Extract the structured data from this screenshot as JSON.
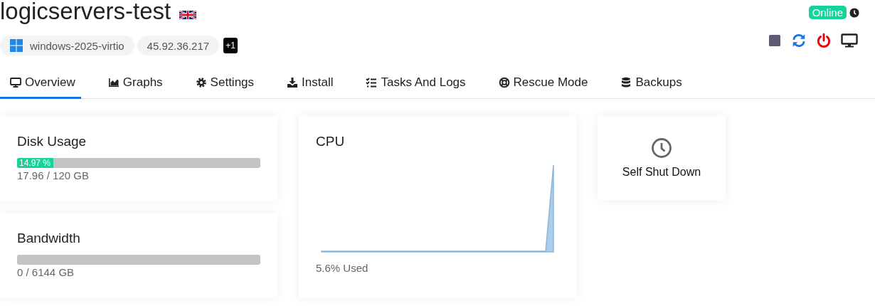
{
  "server": {
    "name": "logicservers-test",
    "status": "Online"
  },
  "chips": [
    {
      "kind": "os",
      "label": "windows-2025-virtio"
    },
    {
      "kind": "ip",
      "label": "45.92.36.217"
    }
  ],
  "extra_count": "+1",
  "tabs": [
    {
      "label": "Overview",
      "selected": true
    },
    {
      "label": "Graphs",
      "selected": false
    },
    {
      "label": "Settings",
      "selected": false
    },
    {
      "label": "Install",
      "selected": false
    },
    {
      "label": "Tasks And Logs",
      "selected": false
    },
    {
      "label": "Rescue Mode",
      "selected": false
    },
    {
      "label": "Backups",
      "selected": false
    }
  ],
  "disk": {
    "title": "Disk Usage",
    "level": 0.1497,
    "percent": "14.97 %",
    "reading": "17.96 / 120 GB"
  },
  "bandwidth": {
    "title": "Bandwidth",
    "level": 0,
    "reading": "0 / 6144 GB"
  },
  "cpu": {
    "title": "CPU",
    "reading": "5.6% Used"
  },
  "self_shutdown": {
    "label": "Self Shut Down"
  }
}
